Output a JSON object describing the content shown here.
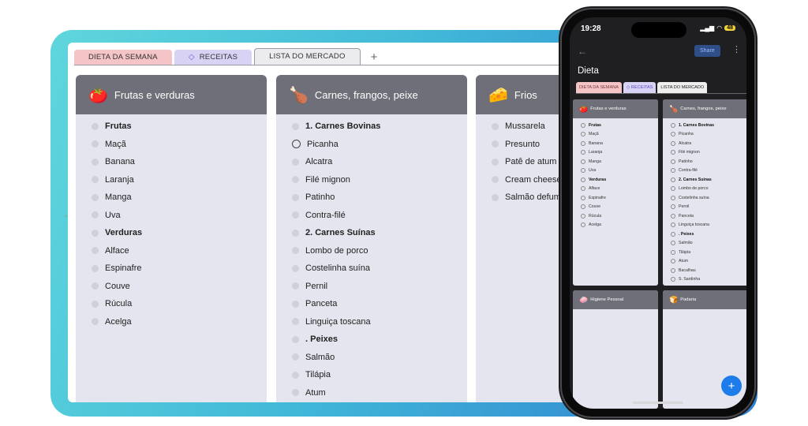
{
  "tabs": [
    {
      "label": "DIETA DA SEMANA"
    },
    {
      "label": "RECEITAS",
      "icon": "diamond-icon"
    },
    {
      "label": "LISTA DO MERCADO"
    }
  ],
  "add_tab_label": "+",
  "columns": [
    {
      "title": "Frutas e verduras",
      "icon": "tomato-icon",
      "items": [
        {
          "label": "Frutas",
          "bold": true
        },
        {
          "label": "Maçã"
        },
        {
          "label": "Banana"
        },
        {
          "label": "Laranja"
        },
        {
          "label": "Manga"
        },
        {
          "label": "Uva"
        },
        {
          "label": "Verduras",
          "bold": true
        },
        {
          "label": "Alface"
        },
        {
          "label": "Espinafre"
        },
        {
          "label": "Couve"
        },
        {
          "label": "Rúcula"
        },
        {
          "label": "Acelga"
        }
      ]
    },
    {
      "title": "Carnes, frangos, peixe",
      "icon": "drumstick-icon",
      "items": [
        {
          "label": "1. Carnes Bovinas",
          "bold": true
        },
        {
          "label": "Picanha",
          "hover": true
        },
        {
          "label": "Alcatra"
        },
        {
          "label": "Filé mignon"
        },
        {
          "label": "Patinho"
        },
        {
          "label": "Contra-filé"
        },
        {
          "label": "2. Carnes Suínas",
          "bold": true
        },
        {
          "label": "Lombo de porco"
        },
        {
          "label": "Costelinha suína"
        },
        {
          "label": "Pernil"
        },
        {
          "label": "Panceta"
        },
        {
          "label": "Linguiça toscana"
        },
        {
          "label": ". Peixes",
          "bold": true
        },
        {
          "label": "Salmão"
        },
        {
          "label": "Tilápia"
        },
        {
          "label": "Atum"
        }
      ]
    },
    {
      "title": "Frios",
      "icon": "cheese-icon",
      "items": [
        {
          "label": "Mussarela"
        },
        {
          "label": "Presunto"
        },
        {
          "label": "Patê de atum"
        },
        {
          "label": "Cream cheese"
        },
        {
          "label": "Salmão defum"
        }
      ]
    }
  ],
  "phone": {
    "time": "19:28",
    "battery": "48",
    "share_label": "Share",
    "more_label": "⋮",
    "back_label": "←",
    "title": "Dieta",
    "tabs": [
      "DIETA DA SEMANA",
      "◇ RECEITAS",
      "LISTA DO MERCADO"
    ],
    "col1": {
      "title": "Frutas e verduras",
      "items": [
        {
          "label": "Frutas",
          "bold": true
        },
        {
          "label": "Maçã"
        },
        {
          "label": "Banana"
        },
        {
          "label": "Laranja"
        },
        {
          "label": "Manga"
        },
        {
          "label": "Uva"
        },
        {
          "label": "Verduras",
          "bold": true
        },
        {
          "label": "Alface"
        },
        {
          "label": "Espinafre"
        },
        {
          "label": "Couve"
        },
        {
          "label": "Rúcula"
        },
        {
          "label": "Acelga"
        }
      ]
    },
    "col2": {
      "title": "Carnes, frangos, peixe",
      "items": [
        {
          "label": "1. Carnes Bovinas",
          "bold": true
        },
        {
          "label": "Picanha"
        },
        {
          "label": "Alcatra"
        },
        {
          "label": "Filé mignon"
        },
        {
          "label": "Patinho"
        },
        {
          "label": "Contra-filé"
        },
        {
          "label": "2. Carnes Suínas",
          "bold": true
        },
        {
          "label": "Lombo de porco"
        },
        {
          "label": "Costelinha suína"
        },
        {
          "label": "Pernil"
        },
        {
          "label": "Panceta"
        },
        {
          "label": "Linguiça toscana"
        },
        {
          "label": ". Peixes",
          "bold": true
        },
        {
          "label": "Salmão"
        },
        {
          "label": "Tilápia"
        },
        {
          "label": "Atum"
        },
        {
          "label": "Bacalhau"
        },
        {
          "label": "S. Sardinha"
        }
      ]
    },
    "col3": {
      "title": "Higiene Pessoal"
    },
    "col4": {
      "title": "Padaria"
    },
    "fab_label": "+"
  }
}
